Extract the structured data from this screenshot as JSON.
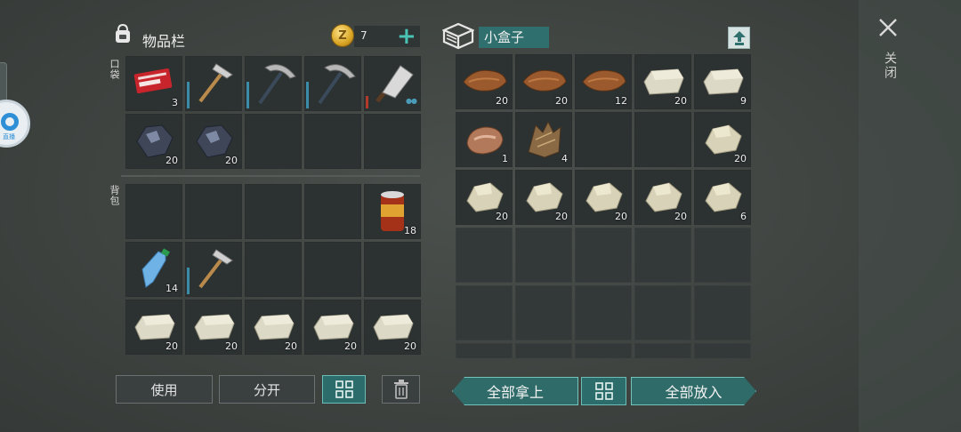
{
  "inventory": {
    "title": "物品栏",
    "coins": "7",
    "pocket_label": "口袋",
    "backpack_label": "背包",
    "pocket": [
      {
        "name": "combat-coupon",
        "qty": "3"
      },
      {
        "name": "hatchet",
        "qty": ""
      },
      {
        "name": "pickaxe",
        "qty": ""
      },
      {
        "name": "pickaxe",
        "qty": ""
      },
      {
        "name": "cleaver",
        "qty": ""
      },
      {
        "name": "iron-ore",
        "qty": "20"
      },
      {
        "name": "iron-ore",
        "qty": "20"
      },
      {
        "name": "empty",
        "qty": ""
      },
      {
        "name": "empty",
        "qty": ""
      },
      {
        "name": "empty",
        "qty": ""
      }
    ],
    "backpack": [
      {
        "name": "empty",
        "qty": ""
      },
      {
        "name": "empty",
        "qty": ""
      },
      {
        "name": "empty",
        "qty": ""
      },
      {
        "name": "empty",
        "qty": ""
      },
      {
        "name": "canned-food",
        "qty": "18"
      },
      {
        "name": "water-bottle",
        "qty": "14"
      },
      {
        "name": "hatchet",
        "qty": ""
      },
      {
        "name": "empty",
        "qty": ""
      },
      {
        "name": "empty",
        "qty": ""
      },
      {
        "name": "empty",
        "qty": ""
      },
      {
        "name": "stone",
        "qty": "20"
      },
      {
        "name": "stone",
        "qty": "20"
      },
      {
        "name": "stone",
        "qty": "20"
      },
      {
        "name": "stone",
        "qty": "20"
      },
      {
        "name": "stone",
        "qty": "20"
      }
    ],
    "buttons": {
      "use": "使用",
      "split": "分开"
    }
  },
  "container": {
    "title": "小盒子",
    "slots": [
      {
        "name": "leather",
        "qty": "20"
      },
      {
        "name": "leather",
        "qty": "20"
      },
      {
        "name": "leather",
        "qty": "12"
      },
      {
        "name": "stone",
        "qty": "20"
      },
      {
        "name": "stone",
        "qty": "9"
      },
      {
        "name": "raw-meat",
        "qty": "1"
      },
      {
        "name": "fur",
        "qty": "4"
      },
      {
        "name": "empty",
        "qty": ""
      },
      {
        "name": "empty",
        "qty": ""
      },
      {
        "name": "rock",
        "qty": "20"
      },
      {
        "name": "rock",
        "qty": "20"
      },
      {
        "name": "rock",
        "qty": "20"
      },
      {
        "name": "rock",
        "qty": "20"
      },
      {
        "name": "rock",
        "qty": "20"
      },
      {
        "name": "rock",
        "qty": "6"
      }
    ],
    "buttons": {
      "take_all": "全部拿上",
      "put_all": "全部放入"
    }
  },
  "close_label": "关闭",
  "colors": {
    "accent": "#2c6c6a",
    "plus": "#49c2b5",
    "slot": "#2c3131"
  }
}
